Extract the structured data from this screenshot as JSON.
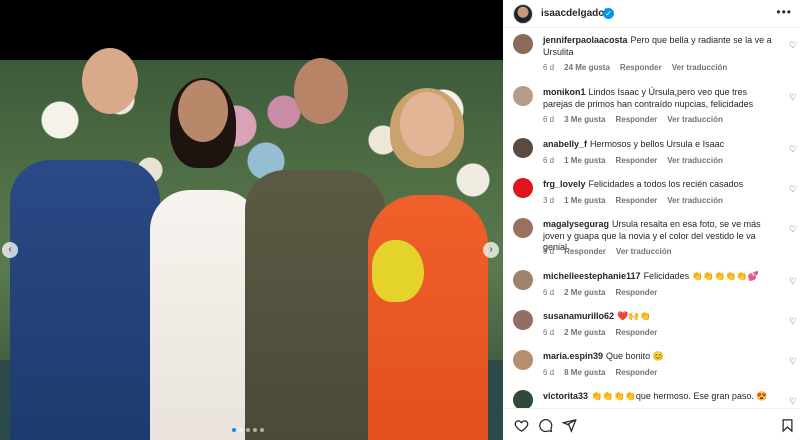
{
  "post": {
    "username": "isaacdelgadob",
    "more_label": "•••"
  },
  "photo": {
    "prev_arrow": "‹",
    "next_arrow": "›",
    "slide_count": 5,
    "active_slide": 1
  },
  "comments": [
    {
      "user": "jenniferpaolaacosta",
      "text": "Pero que bella y radiante se la ve a Ursulita",
      "time": "6 d",
      "likes": "24 Me gusta",
      "reply": "Responder",
      "translate": "Ver traducción",
      "avatar_color": "#8a6a58"
    },
    {
      "user": "monikon1",
      "text": "Lindos Isaac y Úrsula,pero veo que tres parejas de primos han contraído nupcias, felicidades",
      "time": "6 d",
      "likes": "3 Me gusta",
      "reply": "Responder",
      "translate": "Ver traducción",
      "avatar_color": "#b79a88"
    },
    {
      "user": "anabelly_f",
      "text": "Hermosos y bellos Ursula e Isaac",
      "time": "6 d",
      "likes": "1 Me gusta",
      "reply": "Responder",
      "translate": "Ver traducción",
      "avatar_color": "#5a4a40"
    },
    {
      "user": "frg_lovely",
      "text": "Felicidades a todos los recién casados",
      "time": "3 d",
      "likes": "1 Me gusta",
      "reply": "Responder",
      "translate": "Ver traducción",
      "avatar_color": "#e0141b"
    },
    {
      "user": "magalysegurag",
      "text": "Ursula resalta en esa foto, se ve más joven y guapa que la novia y el color del vestido le va genial.",
      "time": "6 d",
      "likes": "",
      "reply": "Responder",
      "translate": "Ver traducción",
      "avatar_color": "#9a7060"
    },
    {
      "user": "michelleestephanie117",
      "text": "Felicidades 👏👏👏👏👏💕",
      "time": "6 d",
      "likes": "2 Me gusta",
      "reply": "Responder",
      "translate": "",
      "avatar_color": "#a0826c"
    },
    {
      "user": "susanamurillo62",
      "text": "❤️🙌👏",
      "time": "6 d",
      "likes": "2 Me gusta",
      "reply": "Responder",
      "translate": "",
      "avatar_color": "#8f6f66"
    },
    {
      "user": "maria.espin39",
      "text": "Que bonito 😊",
      "time": "6 d",
      "likes": "8 Me gusta",
      "reply": "Responder",
      "translate": "",
      "avatar_color": "#b58e70"
    },
    {
      "user": "victorita33",
      "text": "👏👏👏👏que hermoso. Ese gran paso. 😍",
      "time": "",
      "likes": "",
      "reply": "",
      "translate": "",
      "avatar_color": "#2f4a3a"
    }
  ],
  "icons": {
    "heart": "heart-icon",
    "comment": "comment-icon",
    "share": "share-icon",
    "save": "bookmark-icon"
  },
  "colors": {
    "accent": "#0095f6",
    "text": "#262626",
    "muted": "#737373"
  }
}
